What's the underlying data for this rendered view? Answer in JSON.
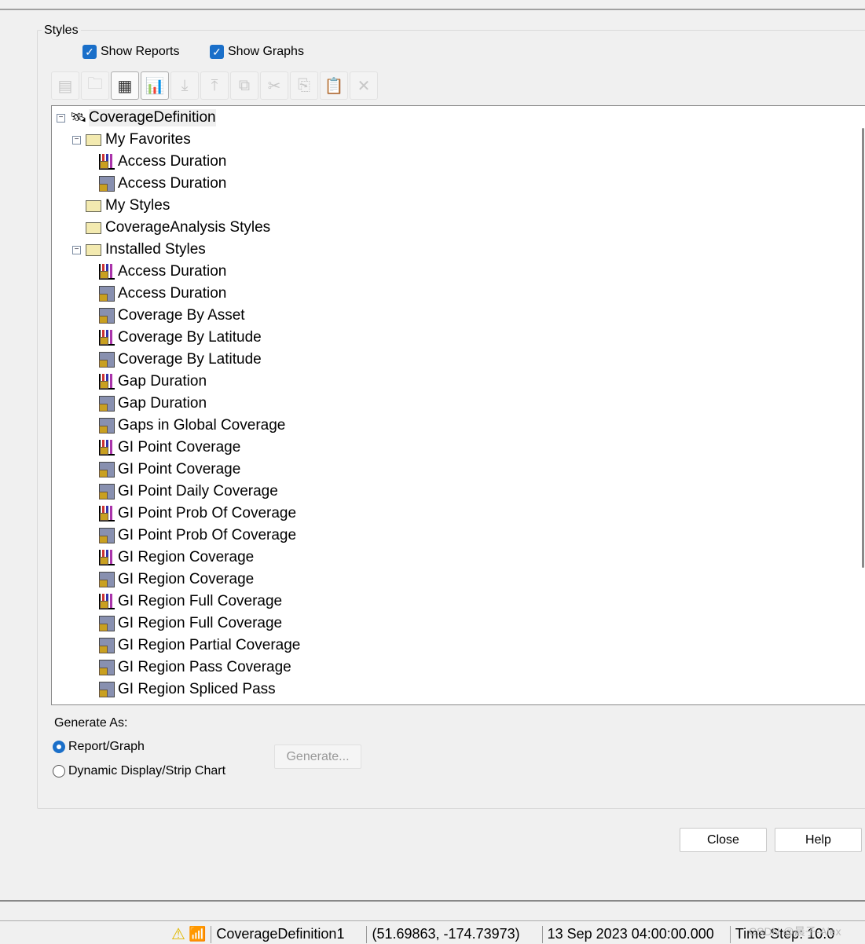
{
  "group": {
    "label": "Styles"
  },
  "checkboxes": [
    {
      "label": "Show Reports",
      "checked": true
    },
    {
      "label": "Show Graphs",
      "checked": true
    }
  ],
  "toolbar": [
    {
      "icon": "properties-icon",
      "enabled": false
    },
    {
      "icon": "new-folder-icon",
      "enabled": false
    },
    {
      "icon": "new-report-icon",
      "enabled": true
    },
    {
      "icon": "new-graph-icon",
      "enabled": true
    },
    {
      "icon": "import-icon",
      "enabled": false
    },
    {
      "icon": "export-icon",
      "enabled": false
    },
    {
      "icon": "duplicate-icon",
      "enabled": false
    },
    {
      "icon": "cut-icon",
      "enabled": false
    },
    {
      "icon": "copy-icon",
      "enabled": false
    },
    {
      "icon": "paste-icon",
      "enabled": false
    },
    {
      "icon": "delete-icon",
      "enabled": false
    }
  ],
  "tree": [
    {
      "label": "CoverageDefinition",
      "type": "root",
      "level": 0,
      "expanded": true,
      "selected": true
    },
    {
      "label": "My Favorites",
      "type": "folder",
      "level": 1,
      "expanded": true
    },
    {
      "label": "Access Duration",
      "type": "graph",
      "level": 2
    },
    {
      "label": "Access Duration",
      "type": "report",
      "level": 2
    },
    {
      "label": "My Styles",
      "type": "folder",
      "level": 1
    },
    {
      "label": "CoverageAnalysis Styles",
      "type": "folder",
      "level": 1
    },
    {
      "label": "Installed Styles",
      "type": "folder",
      "level": 1,
      "expanded": true
    },
    {
      "label": "Access Duration",
      "type": "graph",
      "level": 2
    },
    {
      "label": "Access Duration",
      "type": "report",
      "level": 2
    },
    {
      "label": "Coverage By Asset",
      "type": "report",
      "level": 2
    },
    {
      "label": "Coverage By Latitude",
      "type": "graph",
      "level": 2
    },
    {
      "label": "Coverage By Latitude",
      "type": "report",
      "level": 2
    },
    {
      "label": "Gap Duration",
      "type": "graph",
      "level": 2
    },
    {
      "label": "Gap Duration",
      "type": "report",
      "level": 2
    },
    {
      "label": "Gaps in Global Coverage",
      "type": "report",
      "level": 2
    },
    {
      "label": "GI Point Coverage",
      "type": "graph",
      "level": 2
    },
    {
      "label": "GI Point Coverage",
      "type": "report",
      "level": 2
    },
    {
      "label": "GI Point Daily Coverage",
      "type": "report",
      "level": 2
    },
    {
      "label": "GI Point Prob Of Coverage",
      "type": "graph",
      "level": 2
    },
    {
      "label": "GI Point Prob Of Coverage",
      "type": "report",
      "level": 2
    },
    {
      "label": "GI Region Coverage",
      "type": "graph",
      "level": 2
    },
    {
      "label": "GI Region Coverage",
      "type": "report",
      "level": 2
    },
    {
      "label": "GI Region Full Coverage",
      "type": "graph",
      "level": 2
    },
    {
      "label": "GI Region Full Coverage",
      "type": "report",
      "level": 2
    },
    {
      "label": "GI Region Partial Coverage",
      "type": "report",
      "level": 2
    },
    {
      "label": "GI Region Pass Coverage",
      "type": "report",
      "level": 2
    },
    {
      "label": "GI Region Spliced Pass",
      "type": "report",
      "level": 2
    }
  ],
  "generate": {
    "label": "Generate As:",
    "options": [
      {
        "label": "Report/Graph",
        "selected": true
      },
      {
        "label": "Dynamic Display/Strip Chart",
        "selected": false
      }
    ],
    "button": "Generate..."
  },
  "buttons": {
    "close": "Close",
    "help": "Help"
  },
  "statusbar": {
    "object": "CoverageDefinition1",
    "coords": "(51.69863, -174.73973)",
    "time": "13 Sep 2023 04:00:00.000",
    "timestep": "Time Step: 10.0",
    "watermark": "CSDN @晨子-Alex"
  },
  "colors": {
    "accent": "#1a6fc9"
  }
}
